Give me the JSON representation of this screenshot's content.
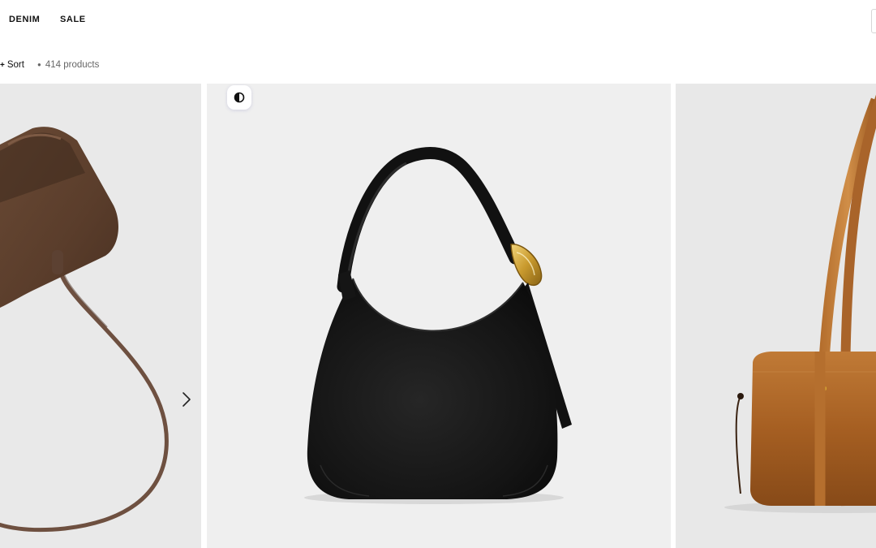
{
  "nav": {
    "items": [
      {
        "label": "DENIM"
      },
      {
        "label": "SALE"
      }
    ]
  },
  "toolbar": {
    "sort_label": "Sort",
    "product_count": "414 products"
  },
  "products": [
    {
      "color": "brown suede",
      "icon": "handbag-image"
    },
    {
      "color": "black leather",
      "icon": "handbag-image"
    },
    {
      "color": "cognac leather",
      "icon": "handbag-image"
    }
  ],
  "icons": {
    "carousel_next": "chevron-right-icon",
    "theme_toggle": "contrast-icon",
    "sort_plus": "plus-icon"
  },
  "colors": {
    "text": "#111111",
    "muted": "#666666",
    "card_bg": "#efefef",
    "toggle_accent": "#6b6bd6"
  }
}
